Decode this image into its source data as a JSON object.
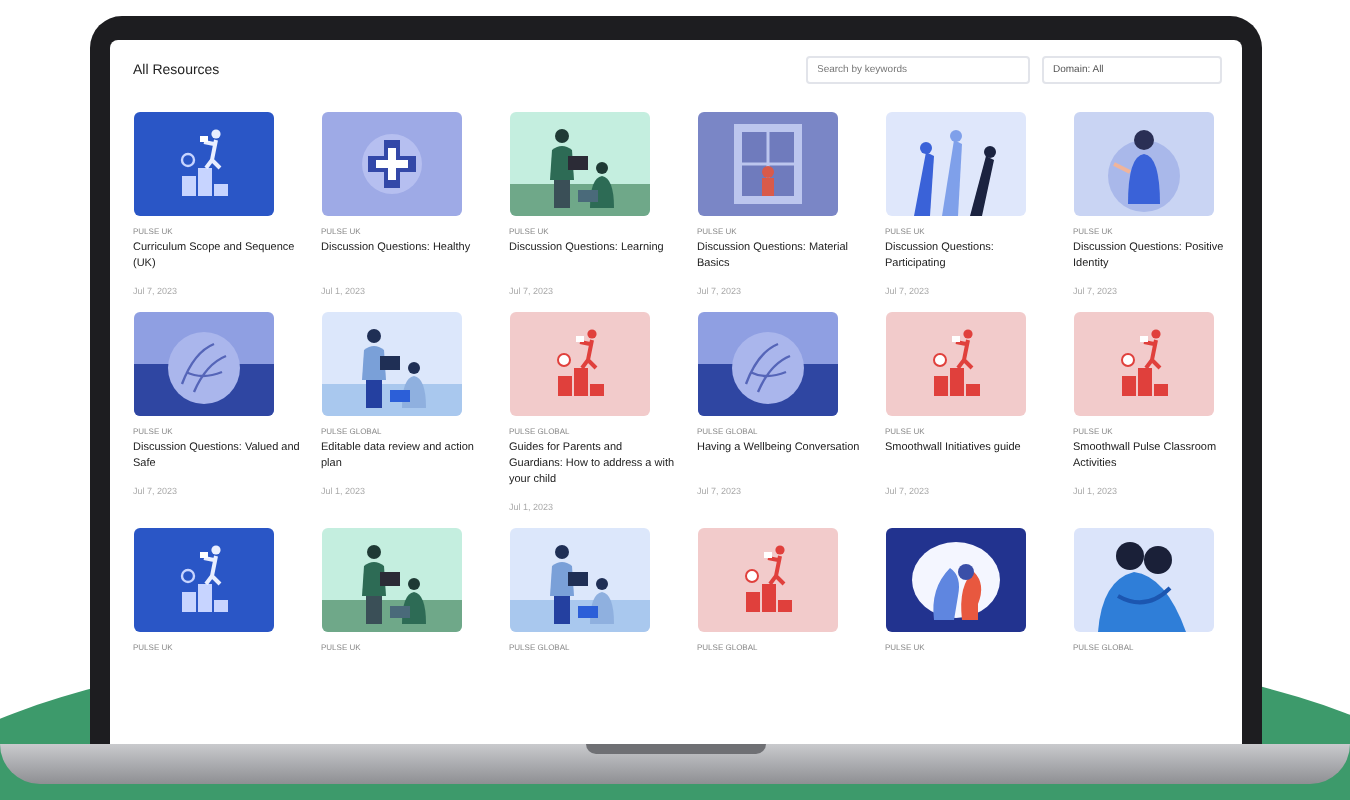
{
  "screen": {
    "title": "All Resources",
    "search": {
      "placeholder": "Search by keywords"
    },
    "domain_filter": {
      "value": "Domain: All"
    }
  },
  "rows": [
    [
      {
        "kind": "stepsblue",
        "category": "PULSE UK",
        "title": "Curriculum Scope and Sequence (UK)",
        "date": "Jul 7, 2023"
      },
      {
        "kind": "medical",
        "category": "PULSE UK",
        "title": "Discussion Questions: Healthy",
        "date": "Jul 1, 2023"
      },
      {
        "kind": "teamgreen",
        "category": "PULSE UK",
        "title": "Discussion Questions: Learning",
        "date": "Jul 7, 2023"
      },
      {
        "kind": "window",
        "category": "PULSE UK",
        "title": "Discussion Questions: Material Basics",
        "date": "Jul 7, 2023"
      },
      {
        "kind": "raisedhands",
        "category": "PULSE UK",
        "title": "Discussion Questions: Participating",
        "date": "Jul 7, 2023"
      },
      {
        "kind": "person",
        "category": "PULSE UK",
        "title": "Discussion Questions: Positive Identity",
        "date": "Jul 7, 2023"
      }
    ],
    [
      {
        "kind": "hands",
        "category": "PULSE UK",
        "title": "Discussion Questions: Valued and Safe",
        "date": "Jul 7, 2023"
      },
      {
        "kind": "teamblue",
        "category": "PULSE GLOBAL",
        "title": "Editable data review and action plan",
        "date": "Jul 1, 2023"
      },
      {
        "kind": "stepspink",
        "category": "PULSE GLOBAL",
        "title": "Guides for Parents and Guardians: How to address a with your child",
        "date": "Jul 1, 2023"
      },
      {
        "kind": "hands",
        "category": "PULSE GLOBAL",
        "title": "Having a Wellbeing Conversation",
        "date": "Jul 7, 2023"
      },
      {
        "kind": "stepspink",
        "category": "PULSE UK",
        "title": "Smoothwall Initiatives guide",
        "date": "Jul 7, 2023"
      },
      {
        "kind": "stepspink",
        "category": "PULSE UK",
        "title": "Smoothwall Pulse Classroom Activities",
        "date": "Jul 1, 2023"
      }
    ],
    [
      {
        "kind": "stepsblue",
        "category": "PULSE UK"
      },
      {
        "kind": "teamgreen",
        "category": "PULSE UK"
      },
      {
        "kind": "teamblue",
        "category": "PULSE GLOBAL"
      },
      {
        "kind": "stepspink",
        "category": "PULSE GLOBAL"
      },
      {
        "kind": "brain",
        "category": "PULSE UK"
      },
      {
        "kind": "hug",
        "category": "PULSE GLOBAL"
      }
    ]
  ]
}
